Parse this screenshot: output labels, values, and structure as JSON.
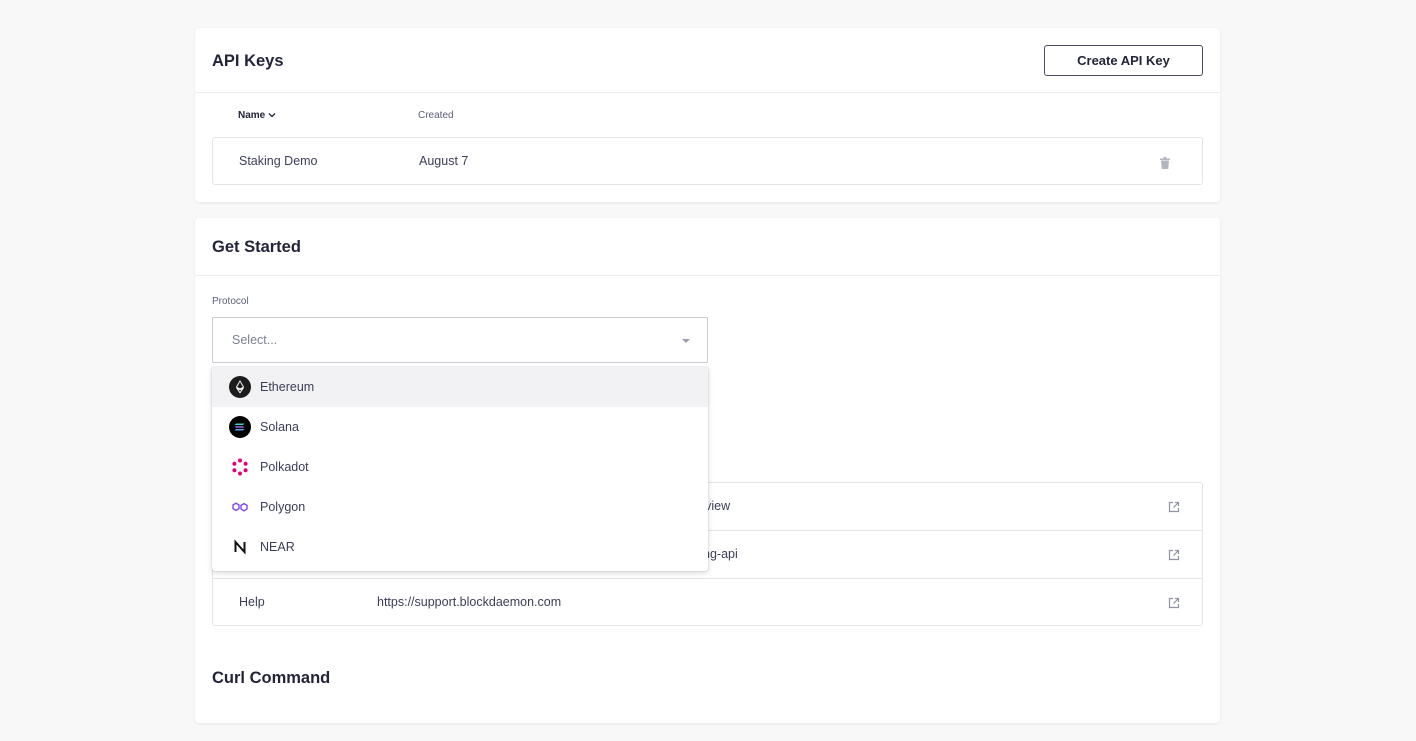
{
  "api_keys": {
    "title": "API Keys",
    "create_button": "Create API Key",
    "columns": {
      "name": "Name",
      "created": "Created"
    },
    "rows": [
      {
        "name": "Staking Demo",
        "created": "August 7"
      }
    ]
  },
  "get_started": {
    "title": "Get Started",
    "protocol_label": "Protocol",
    "select_placeholder": "Select...",
    "options": [
      {
        "label": "Ethereum",
        "icon": "ethereum-icon"
      },
      {
        "label": "Solana",
        "icon": "solana-icon"
      },
      {
        "label": "Polkadot",
        "icon": "polkadot-icon"
      },
      {
        "label": "Polygon",
        "icon": "polygon-icon"
      },
      {
        "label": "NEAR",
        "icon": "near-icon"
      }
    ],
    "links": [
      {
        "name": "",
        "url": "erview"
      },
      {
        "name": "",
        "url": "king-api"
      },
      {
        "name": "Help",
        "url": "https://support.blockdaemon.com"
      }
    ],
    "curl_title": "Curl Command"
  },
  "colors": {
    "text_primary": "#23243a",
    "polkadot": "#e6007a",
    "polygon": "#8247e5"
  }
}
